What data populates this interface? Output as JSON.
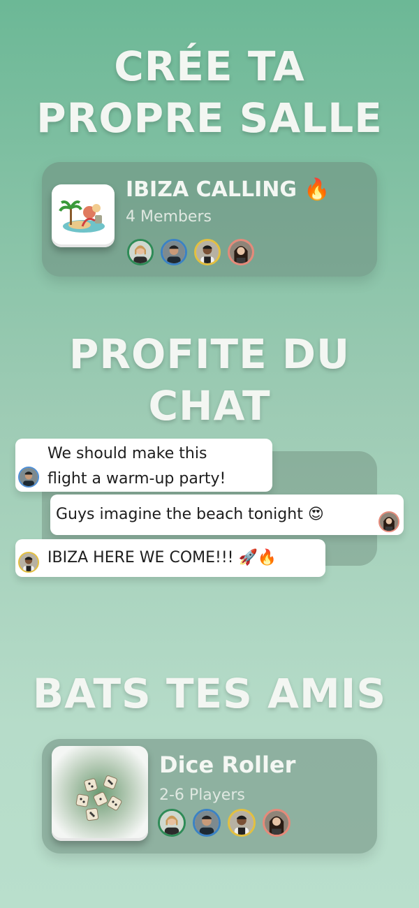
{
  "section1": {
    "heading_line1": "CRÉE TA",
    "heading_line2": "PROPRE SALLE",
    "room": {
      "title": "IBIZA CALLING 🔥",
      "subtitle": "4 Members",
      "thumbnail_icon": "beach-island-icon"
    }
  },
  "section2": {
    "heading_line1": "PROFITE DU",
    "heading_line2": "CHAT",
    "messages": [
      {
        "line1": "We should make this",
        "line2": "flight a warm-up party!"
      },
      {
        "text": "Guys imagine the beach tonight 😍"
      },
      {
        "text": "IBIZA HERE WE COME!!! 🚀🔥"
      }
    ]
  },
  "section3": {
    "heading": "BATS TES AMIS",
    "game": {
      "title": "Dice Roller",
      "subtitle": "2-6 Players",
      "thumbnail_icon": "dice-icon"
    }
  },
  "colors": {
    "avatar_ring_green": "#2e8b57",
    "avatar_ring_blue": "#3b82c4",
    "avatar_ring_yellow": "#e3c040",
    "avatar_ring_red": "#e58a7a"
  }
}
